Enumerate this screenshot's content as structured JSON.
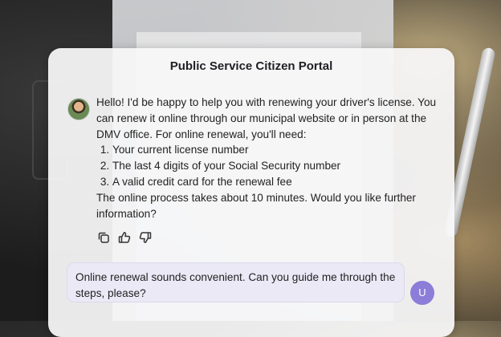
{
  "header": {
    "title": "Public Service Citizen Portal"
  },
  "assistant_message": {
    "intro": "Hello! I'd be happy to help you with renewing your driver's license. You can renew it online through our municipal website or in person at the DMV office. For online renewal, you'll need:",
    "requirements": [
      "Your current license number",
      "The last 4 digits of your Social Security number",
      "A valid credit card for the renewal fee"
    ],
    "outro": "The online process takes about 10 minutes. Would you like further information?"
  },
  "actions": {
    "copy_icon": "copy-icon",
    "thumbs_up_icon": "thumbs-up-icon",
    "thumbs_down_icon": "thumbs-down-icon"
  },
  "user_message": {
    "text": "Online renewal sounds convenient. Can you guide me through the steps, please?",
    "avatar_initial": "U"
  },
  "colors": {
    "user_avatar": "#8b7dd8",
    "user_bubble": "#ebe9f6",
    "card_background": "#f6f6f8"
  }
}
